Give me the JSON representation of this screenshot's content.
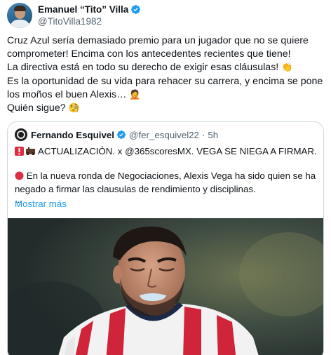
{
  "author": {
    "display_name": "Emanuel “Tito” Villa",
    "handle": "@TitoVilla1982"
  },
  "tweet": {
    "lines": [
      "Cruz Azul sería demasiado premio para un jugador que no se quiere",
      "comprometer! Encima con los antecedentes recientes que tiene!",
      "La directiva está en todo su derecho de exigir esas cláusulas!",
      "Es la oportunidad de su vida para rehacer su carrera, y encima se pone",
      "los moños el buen Alexis…",
      "Quién sigue?"
    ],
    "emoji": {
      "clap": "👏",
      "facepalm": "🤦",
      "monocle": "🧐"
    }
  },
  "quote": {
    "display_name": "Fernando Esquivel",
    "handle": "@fer_esquivel22",
    "separator": "·",
    "time": "5h",
    "headline": "ACTUALIZACIÓN. x @365scoresMX. VEGA SE NIEGA A FIRMAR.",
    "body_line1": "En la nueva ronda de Negociaciones, Alexis Vega ha sido quien se ha",
    "body_line2": "negado a firmar las clausulas de rendimiento y disciplinas.",
    "ellipsis": "...",
    "show_more": "Mostrar más"
  },
  "colors": {
    "link": "#1d9bf0",
    "verified": "#1d9bf0",
    "secondary_text": "#536471",
    "border": "#cfd9de",
    "jersey_red": "#d0243a"
  },
  "icons": [
    "verified-badge-icon",
    "red-alert-badge-icon",
    "red-circle-icon",
    "clap-emoji-icon",
    "facepalm-emoji-icon",
    "monocle-emoji-icon"
  ]
}
